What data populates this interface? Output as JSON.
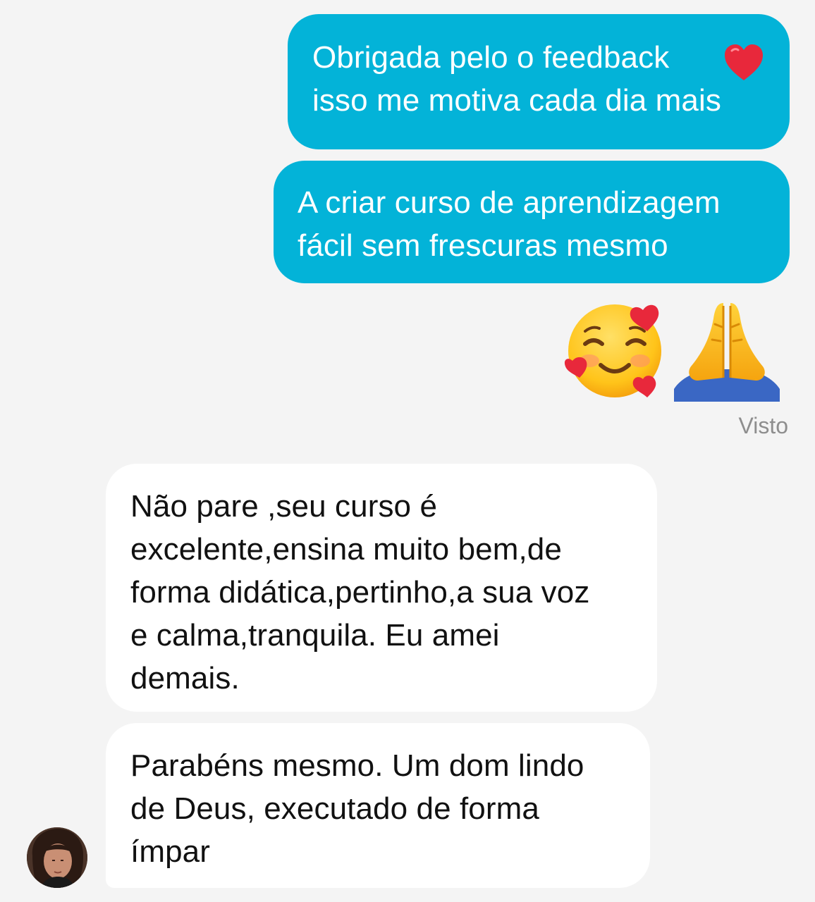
{
  "messages": {
    "sent_1": {
      "text": "Obrigada pelo o feedback\nisso me motiva cada dia mais",
      "trailing_icon": "red-heart-emoji"
    },
    "sent_2": {
      "text": "A criar curso de aprendizagem\nfácil sem frescuras mesmo"
    },
    "sent_emojis": [
      "smiling-face-with-hearts-emoji",
      "folded-hands-emoji"
    ],
    "status": "Visto",
    "received_1": {
      "text": "Não pare ,seu curso é\nexcelente,ensina muito bem,de\nforma didática,pertinho,a sua voz\ne calma,tranquila. Eu amei\ndemais."
    },
    "received_2": {
      "text": "Parabéns mesmo. Um dom lindo\nde Deus, executado de forma\nímpar"
    }
  },
  "colors": {
    "background": "#f4f4f4",
    "sent_bubble": "#03b3d8",
    "received_bubble": "#ffffff",
    "status_text": "#8e8e8e"
  }
}
